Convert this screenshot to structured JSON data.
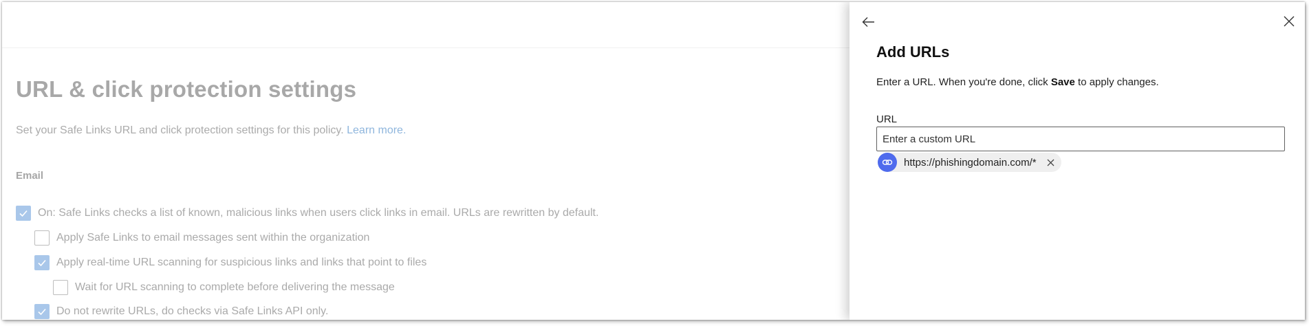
{
  "background_page": {
    "title": "URL & click protection settings",
    "description": "Set your Safe Links URL and click protection settings for this policy.",
    "learn_more_link": "Learn more.",
    "section_heading": "Email",
    "options": [
      {
        "label": "On: Safe Links checks a list of known, malicious links when users click links in email. URLs are rewritten by default.",
        "checked": true
      },
      {
        "label": "Apply Safe Links to email messages sent within the organization",
        "checked": false
      },
      {
        "label": "Apply real-time URL scanning for suspicious links and links that point to files",
        "checked": true
      },
      {
        "label": "Wait for URL scanning to complete before delivering the message",
        "checked": false
      },
      {
        "label": "Do not rewrite URLs, do checks via Safe Links API only.",
        "checked": true
      }
    ]
  },
  "panel": {
    "back_icon": "arrow-left-icon",
    "close_icon": "close-icon",
    "title": "Add URLs",
    "description_before": "Enter a URL. When you're done, click ",
    "description_bold": "Save",
    "description_after": " to apply changes.",
    "field_label": "URL",
    "input_placeholder": "Enter a custom URL",
    "input_value": "",
    "chips": [
      {
        "text": "https://phishingdomain.com/*",
        "icon": "link-icon"
      }
    ]
  },
  "colors": {
    "accent": "#4f6bed",
    "checkbox_checked_dimmed": "#a9c7ea",
    "link_dimmed": "#8fb6dd"
  }
}
